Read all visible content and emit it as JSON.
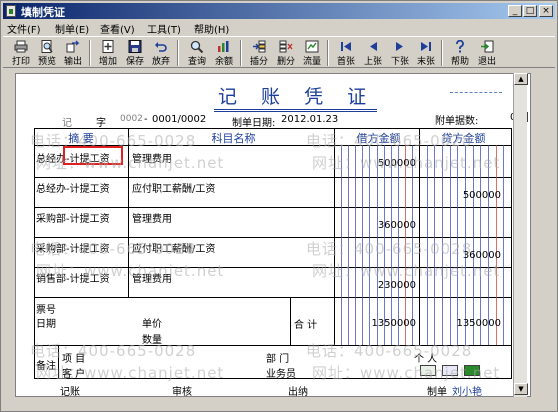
{
  "window": {
    "title": "填制凭证"
  },
  "title_buttons": {
    "minimize": "_",
    "maximize": "□",
    "close": "×"
  },
  "menu": [
    "文件(F)",
    "制单(E)",
    "查看(V)",
    "工具(T)",
    "帮助(H)"
  ],
  "toolbar": [
    {
      "label": "打印",
      "icon": "printer-icon"
    },
    {
      "label": "预览",
      "icon": "preview-icon"
    },
    {
      "label": "输出",
      "icon": "export-icon"
    },
    {
      "label": "增加",
      "icon": "add-icon"
    },
    {
      "label": "保存",
      "icon": "save-icon"
    },
    {
      "label": "放弃",
      "icon": "undo-icon"
    },
    {
      "label": "查询",
      "icon": "search-icon"
    },
    {
      "label": "余额",
      "icon": "balance-chart-icon"
    },
    {
      "label": "插分",
      "icon": "insert-row-icon"
    },
    {
      "label": "删分",
      "icon": "delete-row-icon"
    },
    {
      "label": "流量",
      "icon": "cashflow-icon"
    },
    {
      "label": "首张",
      "icon": "first-icon"
    },
    {
      "label": "上张",
      "icon": "prev-icon"
    },
    {
      "label": "下张",
      "icon": "next-icon"
    },
    {
      "label": "末张",
      "icon": "last-icon"
    },
    {
      "label": "帮助",
      "icon": "help-icon"
    },
    {
      "label": "退出",
      "icon": "exit-icon"
    }
  ],
  "voucher": {
    "heading": "记 账 凭 证",
    "type_label": "记",
    "zi": "字",
    "number_prefix": "0002",
    "number": "0001/0002",
    "date_label": "制单日期:",
    "date": "2012.01.23",
    "attach_label": "附单据数:",
    "attach_value": "0",
    "columns": {
      "summary": "摘 要",
      "subject": "科目名称",
      "debit": "借方金额",
      "credit": "贷方金额"
    },
    "rows": [
      {
        "summary": "总经办-计提工资",
        "subject": "管理费用",
        "debit": "500000",
        "credit": ""
      },
      {
        "summary": "总经办-计提工资",
        "subject": "应付职工薪酬/工资",
        "debit": "",
        "credit": "500000"
      },
      {
        "summary": "采购部-计提工资",
        "subject": "管理费用",
        "debit": "360000",
        "credit": ""
      },
      {
        "summary": "采购部-计提工资",
        "subject": "应付职工薪酬/工资",
        "debit": "",
        "credit": "360000"
      },
      {
        "summary": "销售部-计提工资",
        "subject": "管理费用",
        "debit": "230000",
        "credit": ""
      }
    ],
    "footer": {
      "ticket_no": "票号",
      "date": "日期",
      "unit_price": "单价",
      "quantity": "数量",
      "total_label": "合 计",
      "debit_total": "1350000",
      "credit_total": "1350000",
      "remark": "备注",
      "project": "项    目",
      "customer": "客    户",
      "department": "部    门",
      "salesperson": "业务员",
      "individual": "个    人"
    },
    "signatures": {
      "bookkeeping": "记账",
      "audit": "审核",
      "cashier": "出纳",
      "prepared": "制单",
      "preparer_name": "刘小艳"
    }
  },
  "watermarks": [
    "电话：400-665-0028",
    "网址：www.chanjet.net"
  ],
  "colors": {
    "heading": "#1d3f9a",
    "title_bar": "#0a246a",
    "money_line_red": "#d04040",
    "money_line_blue": "#3a4cc0",
    "highlight": "#e02020"
  }
}
